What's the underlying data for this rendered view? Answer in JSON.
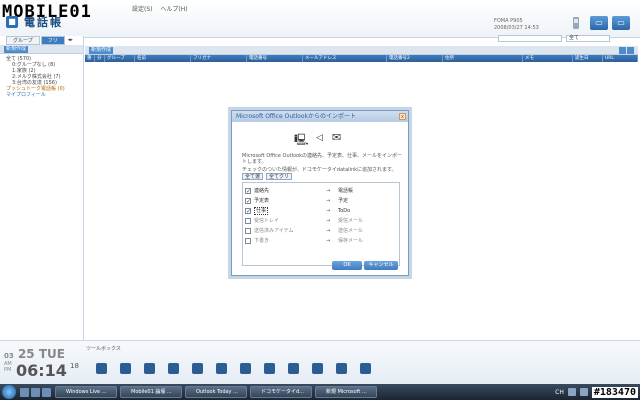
{
  "app": {
    "watermark": "MOBILE01",
    "title": "電話帳",
    "menu": [
      "設定(S)",
      "ヘルプ(H)"
    ],
    "device_model": "FOMA P905",
    "device_date": "2008/03/27 14:53",
    "filter_value": "全て"
  },
  "left": {
    "tabs": [
      "グループ",
      "フリ"
    ],
    "new_button": "新規作成",
    "tree": [
      {
        "label": "全て (570)",
        "level": 0
      },
      {
        "label": "0:グループなし (8)",
        "level": 1
      },
      {
        "label": "1:家族 (2)",
        "level": 1
      },
      {
        "label": "2:メルク株式会社 (7)",
        "level": 1
      },
      {
        "label": "3:台湾の友達 (156)",
        "level": 1
      },
      {
        "label": "プッシュトーク電話帳 (0)",
        "level": 0,
        "style": "highlight"
      },
      {
        "label": "マイプロフィール",
        "level": 0,
        "style": "link"
      }
    ]
  },
  "main": {
    "new_button": "新規作成",
    "columns": [
      "重",
      "分",
      "グループ",
      "名前",
      "フリガナ",
      "電話番号",
      "メールアドレス",
      "電話番号2",
      "住所",
      "メモ",
      "誕生日",
      "URL"
    ]
  },
  "dialog": {
    "title": "Microsoft Office Outlookからのインポート",
    "close": "x",
    "description": "Microsoft Office Outlookの連絡先、予定表、仕事、メールをインポートします。",
    "note": "チェックのついた情報が、ドコモケータイdatalinkに追加されます。",
    "select_all": "全て選",
    "clear_all": "全てクリ",
    "items": [
      {
        "source": "連絡先",
        "target": "電話帳",
        "checked": true,
        "disabled": false,
        "selected": false
      },
      {
        "source": "予定表",
        "target": "予定",
        "checked": true,
        "disabled": false,
        "selected": false
      },
      {
        "source": "仕事",
        "target": "ToDo",
        "checked": true,
        "disabled": false,
        "selected": true
      },
      {
        "source": "受信トレイ",
        "target": "受信メール",
        "checked": false,
        "disabled": true,
        "selected": false
      },
      {
        "source": "送信済みアイテム",
        "target": "送信メール",
        "checked": false,
        "disabled": true,
        "selected": false
      },
      {
        "source": "下書き",
        "target": "保存メール",
        "checked": false,
        "disabled": true,
        "selected": false
      }
    ],
    "arrow": "→",
    "ok": "OK",
    "cancel": "キャンセル"
  },
  "bottom": {
    "date_day": "03",
    "date_num": "25",
    "date_weekday": "TUE",
    "ampm_am": "AM",
    "ampm_pm": "PM",
    "time": "06:14",
    "seconds": "18",
    "tools_label": "ツールボックス"
  },
  "taskbar": {
    "tasks": [
      "Windows Live ...",
      "Mobile01 論壇 ...",
      "Outlook Today ...",
      "ドコモケータイd...",
      "新規 Microsoft ..."
    ],
    "lang": "CH",
    "stamp": "#183470"
  }
}
